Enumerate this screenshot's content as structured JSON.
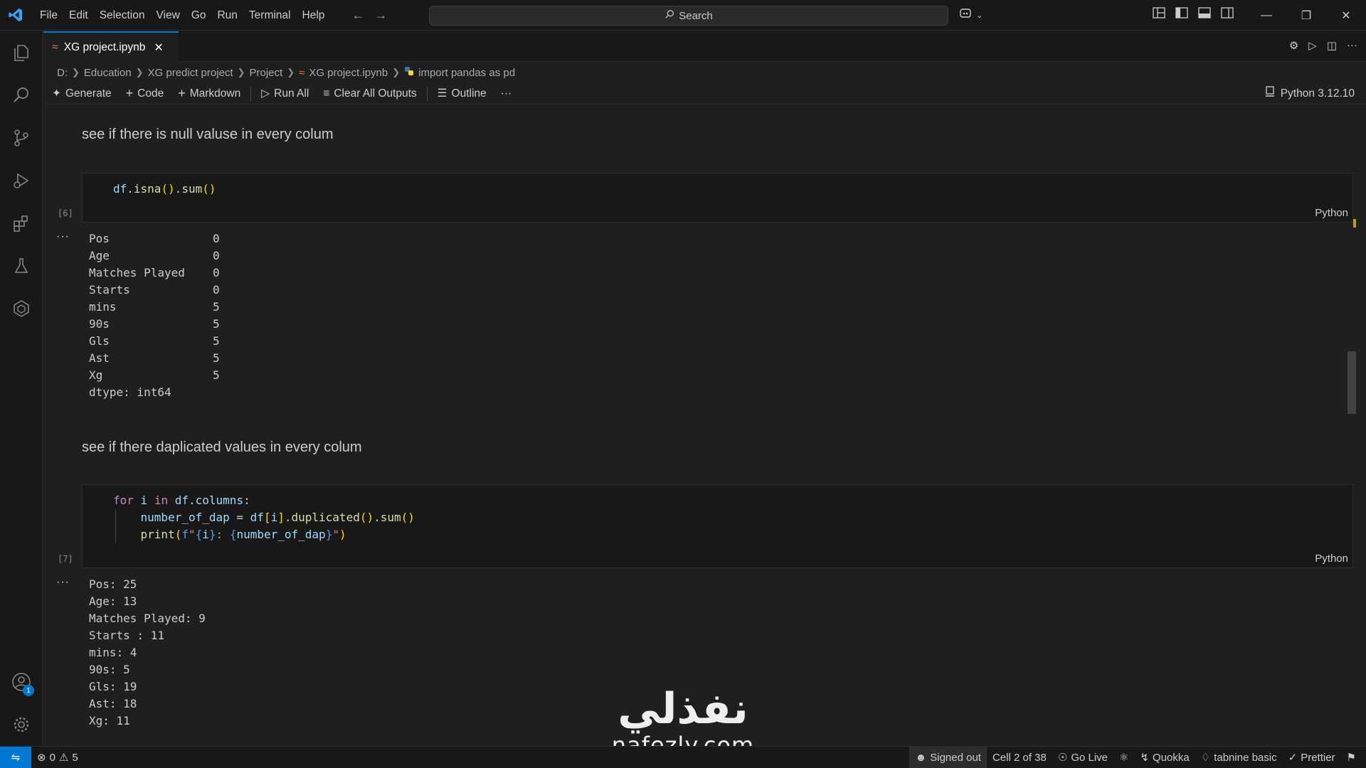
{
  "menu": [
    "File",
    "Edit",
    "Selection",
    "View",
    "Go",
    "Run",
    "Terminal",
    "Help"
  ],
  "search": {
    "label": "Search"
  },
  "tab": {
    "title": "XG project.ipynb"
  },
  "breadcrumb": [
    "D:",
    "Education",
    "XG predict project",
    "Project",
    "XG project.ipynb",
    "import pandas as pd"
  ],
  "toolbar": {
    "generate": "Generate",
    "code": "Code",
    "markdown": "Markdown",
    "run_all": "Run All",
    "clear_outputs": "Clear All Outputs",
    "outline": "Outline",
    "more": "···",
    "kernel": "Python 3.12.10"
  },
  "cells": {
    "md1": "see if there is null valuse in every colum",
    "code1": {
      "exec": "[6]",
      "lang": "Python",
      "line1": {
        "a": "df",
        "b": ".",
        "c": "isna",
        "d": "(",
        "e": ")",
        "f": ".",
        "g": "sum",
        "h": "(",
        "i": ")"
      }
    },
    "out1": {
      "dots": "···",
      "rows": [
        {
          "k": "Pos",
          "v": "0"
        },
        {
          "k": "Age",
          "v": "0"
        },
        {
          "k": "Matches Played",
          "v": "0"
        },
        {
          "k": "Starts",
          "v": "0"
        },
        {
          "k": "mins",
          "v": "5"
        },
        {
          "k": "90s",
          "v": "5"
        },
        {
          "k": "Gls",
          "v": "5"
        },
        {
          "k": "Ast",
          "v": "5"
        },
        {
          "k": "Xg",
          "v": "5"
        }
      ],
      "dtype": "dtype: int64"
    },
    "md2": "see if there daplicated values in every colum",
    "code2": {
      "exec": "[7]",
      "lang": "Python"
    },
    "out2": {
      "dots": "···",
      "rows": [
        "Pos: 25",
        "Age: 13",
        "Matches Played: 9",
        "Starts : 11",
        "mins: 4",
        "90s: 5",
        "Gls: 19",
        "Ast: 18",
        "Xg: 11"
      ]
    }
  },
  "watermark": {
    "logo": "نفذلي",
    "url": "nafezly.com"
  },
  "status": {
    "errors": "0",
    "warnings": "5",
    "signed_out": "Signed out",
    "cell": "Cell 2 of 38",
    "go_live": "Go Live",
    "quokka": "Quokka",
    "tabnine": "tabnine basic",
    "prettier": "Prettier"
  },
  "accounts_badge": "1"
}
